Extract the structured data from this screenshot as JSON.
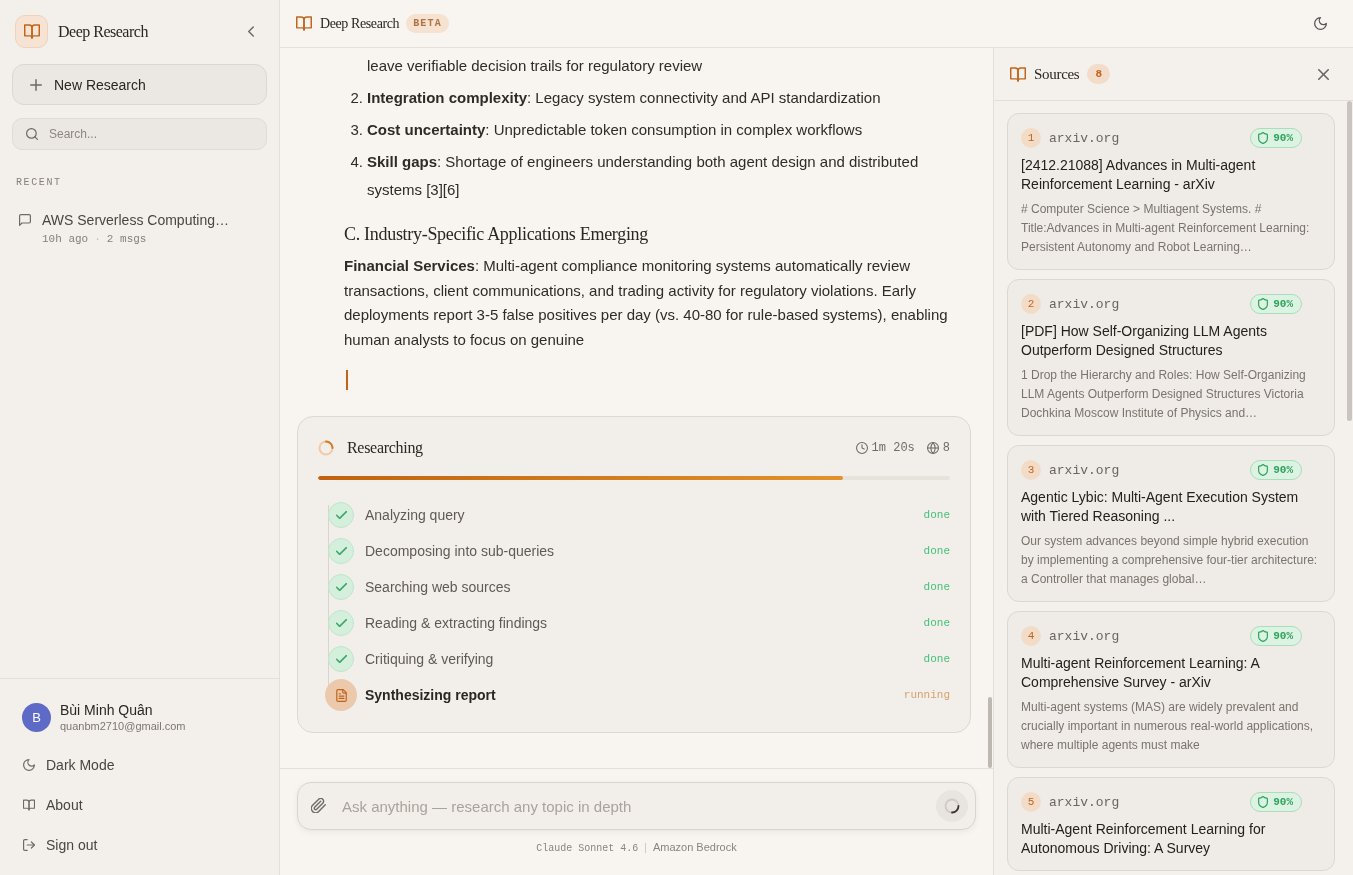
{
  "sidebar": {
    "app_name": "Deep Research",
    "new_button": "New Research",
    "search": {
      "placeholder": "Search..."
    },
    "recent_heading": "RECENT",
    "recent": [
      {
        "title": "AWS Serverless Computing…",
        "time": "10h ago",
        "separator": "·",
        "count": "2 msgs"
      }
    ],
    "user": {
      "initial": "B",
      "name": "Bùi Minh Quân",
      "email": "quanbm2710@gmail.com"
    },
    "menu": [
      {
        "label": "Dark Mode",
        "kind": "theme"
      },
      {
        "label": "About",
        "kind": "about"
      },
      {
        "label": "Sign out",
        "kind": "signout"
      }
    ]
  },
  "header": {
    "title": "Deep Research",
    "badge": "BETA"
  },
  "report": {
    "partial_line": "leave verifiable decision trails for regulatory review",
    "list": [
      {
        "number": "2.",
        "text": "**Integration complexity**: Legacy system connectivity and API standardization"
      },
      {
        "number": "3.",
        "text": "**Cost uncertainty**: Unpredictable token consumption in complex workflows"
      },
      {
        "number": "4.",
        "text": "**Skill gaps**: Shortage of engineers understanding both agent design and distributed systems [3][6]"
      }
    ],
    "heading": "C. Industry-Specific Applications Emerging",
    "paragraph": "**Financial Services**: Multi-agent compliance monitoring systems automatically review transactions, client communications, and trading activity for regulatory violations. Early deployments report 3-5 false positives per day (vs. 40-80 for rule-based systems), enabling human analysts to focus on genuine"
  },
  "progress": {
    "title": "Researching",
    "elapsed": "1m 20s",
    "sources": "8",
    "level": 0.83,
    "steps": [
      {
        "label": "Analyzing query",
        "status": "done",
        "running": false
      },
      {
        "label": "Decomposing into sub-queries",
        "status": "done",
        "running": false
      },
      {
        "label": "Searching web sources",
        "status": "done",
        "running": false
      },
      {
        "label": "Reading & extracting findings",
        "status": "done",
        "running": false
      },
      {
        "label": "Critiquing & verifying",
        "status": "done",
        "running": false
      },
      {
        "label": "Synthesizing report",
        "status": "running",
        "running": true
      }
    ]
  },
  "composer": {
    "placeholder": "Ask anything — research any topic in depth",
    "model": "Claude Sonnet 4.6",
    "separator": "|",
    "provider": "Amazon Bedrock"
  },
  "sources_panel": {
    "title": "Sources",
    "count": "8",
    "items": [
      {
        "number": "1",
        "domain": "arxiv.org",
        "score": "90%",
        "title": "[2412.21088] Advances in Multi-agent Reinforcement Learning - arXiv",
        "snippet": "# Computer Science > Multiagent Systems. # Title:Advances in Multi-agent Reinforcement Learning: Persistent Autonomy and Robot Learning…"
      },
      {
        "number": "2",
        "domain": "arxiv.org",
        "score": "90%",
        "title": "[PDF] How Self-Organizing LLM Agents Outperform Designed Structures",
        "snippet": "1 Drop the Hierarchy and Roles: How Self-Organizing LLM Agents Outperform Designed Structures Victoria Dochkina Moscow Institute of Physics and…"
      },
      {
        "number": "3",
        "domain": "arxiv.org",
        "score": "90%",
        "title": "Agentic Lybic: Multi-Agent Execution System with Tiered Reasoning ...",
        "snippet": "Our system advances beyond simple hybrid execution by implementing a comprehensive four-tier architecture: a Controller that manages global…"
      },
      {
        "number": "4",
        "domain": "arxiv.org",
        "score": "90%",
        "title": "Multi-agent Reinforcement Learning: A Comprehensive Survey - arXiv",
        "snippet": "Multi-agent systems (MAS) are widely prevalent and crucially important in numerous real-world applications, where multiple agents must make"
      },
      {
        "number": "5",
        "domain": "arxiv.org",
        "score": "90%",
        "title": "Multi-Agent Reinforcement Learning for Autonomous Driving: A Survey"
      }
    ]
  }
}
